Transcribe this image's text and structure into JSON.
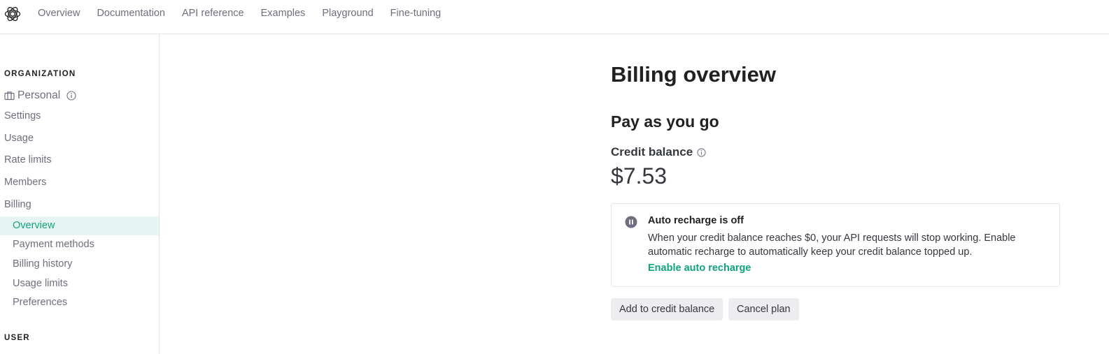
{
  "app": {
    "logo_icon": "openai-logo-icon"
  },
  "nav": {
    "items": [
      {
        "label": "Overview"
      },
      {
        "label": "Documentation"
      },
      {
        "label": "API reference"
      },
      {
        "label": "Examples"
      },
      {
        "label": "Playground"
      },
      {
        "label": "Fine-tuning"
      }
    ]
  },
  "sidebar": {
    "org_heading": "ORGANIZATION",
    "org_name": "Personal",
    "items": [
      {
        "label": "Settings"
      },
      {
        "label": "Usage"
      },
      {
        "label": "Rate limits"
      },
      {
        "label": "Members"
      },
      {
        "label": "Billing"
      }
    ],
    "billing_subitems": [
      {
        "label": "Overview",
        "active": true
      },
      {
        "label": "Payment methods"
      },
      {
        "label": "Billing history"
      },
      {
        "label": "Usage limits"
      },
      {
        "label": "Preferences"
      }
    ],
    "user_heading": "USER"
  },
  "main": {
    "title": "Billing overview",
    "plan_title": "Pay as you go",
    "credit_label": "Credit balance",
    "credit_balance": "$7.53",
    "notice": {
      "title": "Auto recharge is off",
      "body": "When your credit balance reaches $0, your API requests will stop working. Enable automatic recharge to automatically keep your credit balance topped up.",
      "link": "Enable auto recharge"
    },
    "buttons": {
      "add_credit": "Add to credit balance",
      "cancel_plan": "Cancel plan"
    }
  },
  "colors": {
    "accent": "#10a37f",
    "active_bg": "#e7f5f2",
    "muted_text": "#6e6e80",
    "button_bg": "#ececf1"
  }
}
